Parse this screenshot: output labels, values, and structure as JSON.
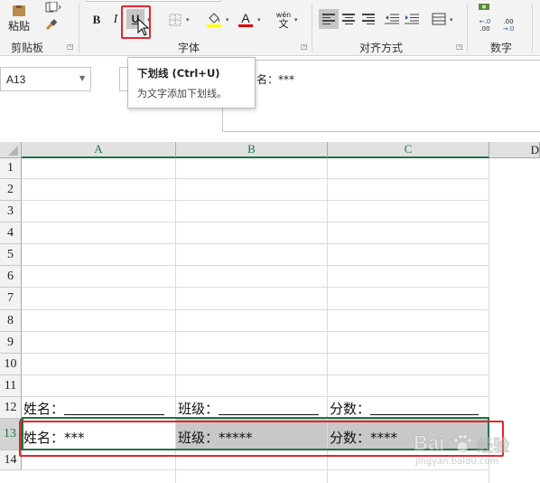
{
  "ribbon": {
    "clipboard": {
      "paste_label": "粘贴",
      "group_label": "剪贴板"
    },
    "font": {
      "bold_label": "B",
      "italic_label": "I",
      "underline_label": "U",
      "phonetic_label": "wén",
      "phonetic_char": "文",
      "font_color_glyph": "A",
      "group_label": "字体"
    },
    "alignment": {
      "group_label": "对齐方式"
    },
    "number": {
      "group_label": "数字",
      "dec_increase_label": "←.0\n.00",
      "dec_decrease_label": ".00\n→.0"
    }
  },
  "formula_bar": {
    "name_box": "A13",
    "formula_text": "名：***"
  },
  "tooltip": {
    "title": "下划线 (Ctrl+U)",
    "description": "为文字添加下划线。"
  },
  "grid": {
    "columns": [
      "A",
      "B",
      "C"
    ],
    "next_column_partial": "D",
    "rows": [
      "1",
      "2",
      "3",
      "4",
      "5",
      "6",
      "7",
      "8",
      "9",
      "10",
      "11",
      "12",
      "13",
      "14"
    ],
    "selected_row": "13",
    "row12": {
      "a_label": "姓名：",
      "b_label": "班级：",
      "c_label": "分数："
    },
    "row13": {
      "a": "姓名：***",
      "b": "班级：*****",
      "c": "分数：****"
    }
  },
  "watermark": {
    "brand": "Bai",
    "brand2": "经验",
    "url": "jingyan.baidu.com"
  },
  "colors": {
    "accent_green": "#217346",
    "highlight_red": "#e6262e",
    "selected_fill": "#c8c8c8"
  }
}
